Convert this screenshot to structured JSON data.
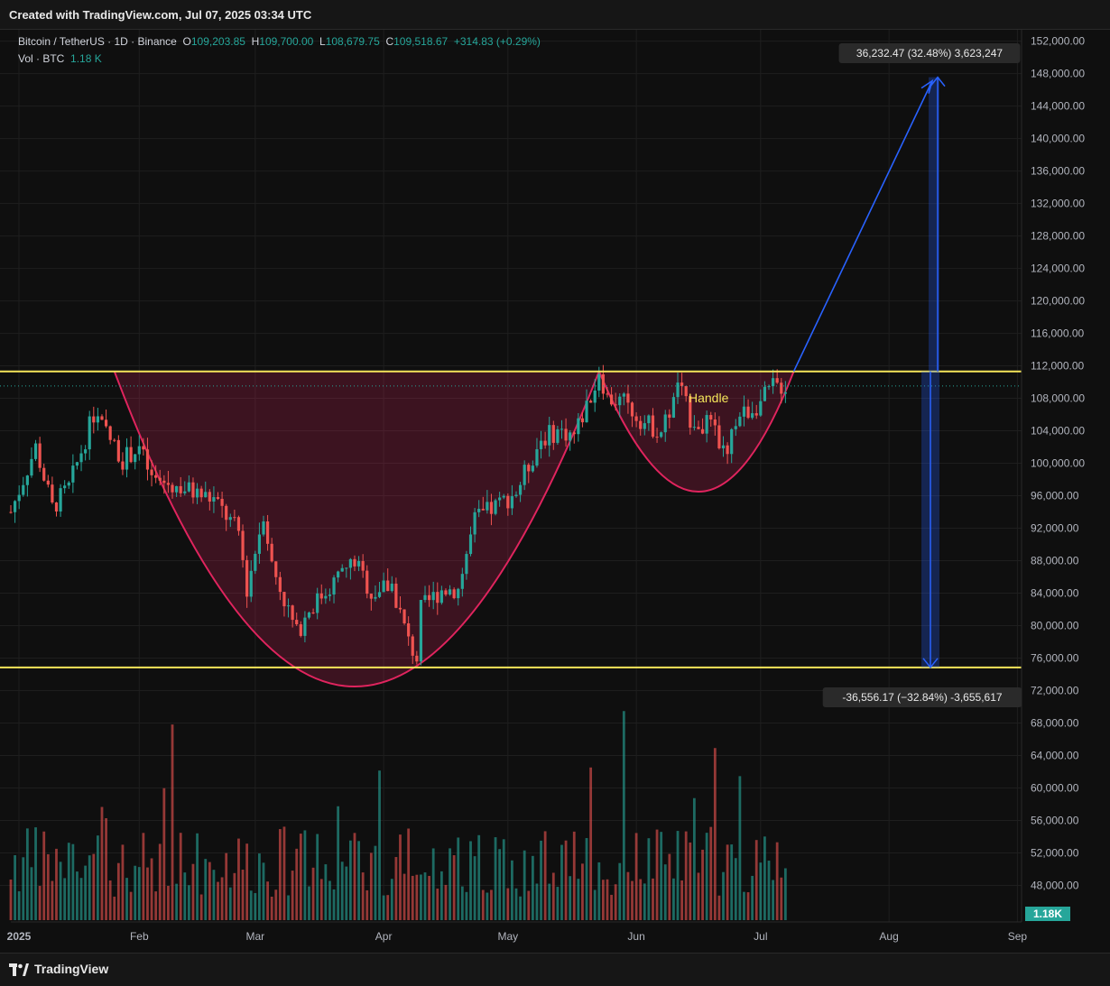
{
  "header": {
    "created_text": "Created with TradingView.com, Jul 07, 2025 03:34 UTC",
    "symbol": "Bitcoin / TetherUS · 1D · Binance",
    "o_label": "O",
    "o_value": "109,203.85",
    "h_label": "H",
    "h_value": "109,700.00",
    "l_label": "L",
    "l_value": "108,679.75",
    "c_label": "C",
    "c_value": "109,518.67",
    "change": "+314.83 (+0.29%)",
    "vol_label": "Vol · BTC",
    "vol_value": "1.18 K"
  },
  "footer": {
    "brand": "TradingView"
  },
  "colors": {
    "up": "#26a69a",
    "down": "#ef5350",
    "level": "#f5e65a",
    "pattern": "#e0245e",
    "projection": "#2962ff"
  },
  "chart_data": {
    "type": "candlestick",
    "title": "Bitcoin / TetherUS · 1D · Binance",
    "y_ticks": [
      "48,000.00",
      "52,000.00",
      "56,000.00",
      "60,000.00",
      "64,000.00",
      "68,000.00",
      "72,000.00",
      "76,000.00",
      "80,000.00",
      "84,000.00",
      "88,000.00",
      "92,000.00",
      "96,000.00",
      "100,000.00",
      "104,000.00",
      "108,000.00",
      "112,000.00",
      "116,000.00",
      "120,000.00",
      "124,000.00",
      "128,000.00",
      "132,000.00",
      "136,000.00",
      "140,000.00",
      "144,000.00",
      "148,000.00",
      "152,000.00"
    ],
    "x_ticks": [
      "2025",
      "Feb",
      "Mar",
      "Apr",
      "May",
      "Jun",
      "Jul",
      "Aug",
      "Sep"
    ],
    "x_range": [
      "2024-12-31",
      "2025-09-01"
    ],
    "y_range": [
      43500,
      153400
    ],
    "close_path": [
      [
        "2024-12-31",
        94000
      ],
      [
        "2025-01-06",
        102000
      ],
      [
        "2025-01-10",
        94500
      ],
      [
        "2025-01-14",
        97000
      ],
      [
        "2025-01-20",
        106000
      ],
      [
        "2025-01-22",
        104500
      ],
      [
        "2025-01-27",
        100500
      ],
      [
        "2025-01-31",
        102000
      ],
      [
        "2025-02-03",
        98000
      ],
      [
        "2025-02-10",
        97000
      ],
      [
        "2025-02-18",
        95500
      ],
      [
        "2025-02-24",
        91500
      ],
      [
        "2025-02-26",
        84500
      ],
      [
        "2025-03-02",
        94000
      ],
      [
        "2025-03-04",
        87500
      ],
      [
        "2025-03-10",
        79000
      ],
      [
        "2025-03-13",
        82000
      ],
      [
        "2025-03-20",
        86000
      ],
      [
        "2025-03-24",
        88000
      ],
      [
        "2025-03-28",
        84000
      ],
      [
        "2025-04-02",
        85000
      ],
      [
        "2025-04-06",
        78000
      ],
      [
        "2025-04-08",
        76000
      ],
      [
        "2025-04-09",
        82000
      ],
      [
        "2025-04-14",
        84500
      ],
      [
        "2025-04-18",
        84500
      ],
      [
        "2025-04-22",
        93000
      ],
      [
        "2025-04-28",
        95000
      ],
      [
        "2025-05-02",
        96500
      ],
      [
        "2025-05-08",
        103000
      ],
      [
        "2025-05-12",
        104000
      ],
      [
        "2025-05-16",
        103500
      ],
      [
        "2025-05-21",
        109500
      ],
      [
        "2025-05-22",
        111500
      ],
      [
        "2025-05-24",
        108000
      ],
      [
        "2025-05-28",
        107500
      ],
      [
        "2025-06-02",
        105000
      ],
      [
        "2025-06-06",
        104000
      ],
      [
        "2025-06-09",
        107500
      ],
      [
        "2025-06-10",
        110000
      ],
      [
        "2025-06-13",
        105500
      ],
      [
        "2025-06-18",
        104500
      ],
      [
        "2025-06-22",
        100500
      ],
      [
        "2025-06-24",
        105500
      ],
      [
        "2025-06-30",
        107500
      ],
      [
        "2025-07-03",
        109500
      ],
      [
        "2025-07-06",
        109518.67
      ]
    ],
    "volume_axis_range": [
      0,
      60
    ],
    "volume_last": "1.18K",
    "levels": [
      {
        "value": 111319.26,
        "label": "111,319.26"
      },
      {
        "value": 74857.31,
        "label": "74,857.31"
      }
    ],
    "last_price": {
      "value": 109518.67,
      "label": "109,518.67"
    },
    "annotations": {
      "handle_label": "Handle",
      "measure_up": "36,232.47 (32.48%) 3,623,247",
      "measure_down": "-36,556.17 (−32.84%) -3,655,617"
    },
    "pattern": {
      "cup": {
        "start": [
          "2025-01-25",
          111319.26
        ],
        "bottom": [
          "2025-03-24",
          72500
        ],
        "end": [
          "2025-05-22",
          111319.26
        ]
      },
      "handle": {
        "start": [
          "2025-05-22",
          111319.26
        ],
        "bottom": [
          "2025-06-15",
          96500
        ],
        "end": [
          "2025-07-08",
          111319.26
        ]
      },
      "target": [
        "2025-08-10",
        147551.73
      ],
      "measure_date": "2025-08-10"
    }
  }
}
